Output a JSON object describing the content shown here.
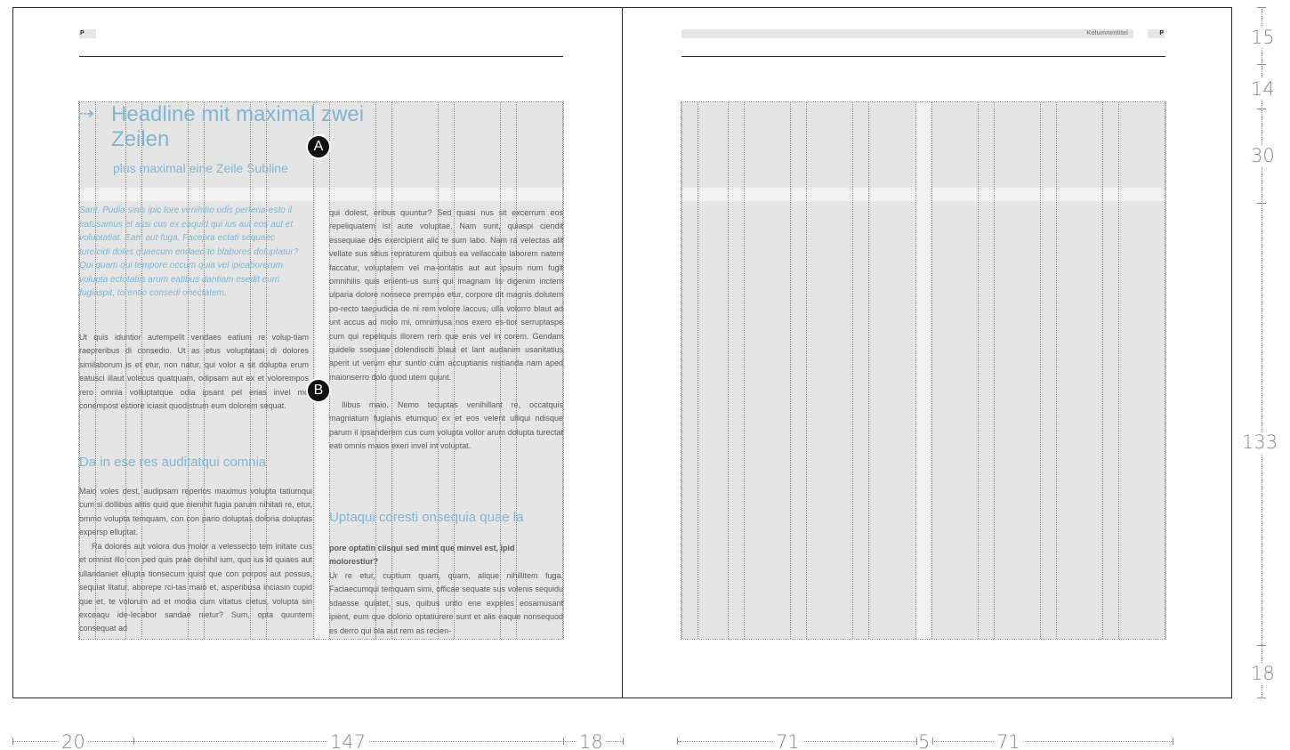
{
  "left_page": {
    "page_marker": "P",
    "headline": "Headline mit maximal zwei Zeilen",
    "headline_arrow": "⇢",
    "subline": "plus maximal eine Zeile Subline",
    "intro": "Sant. Pudia sinis ipic tore venihitio odis perferia-esto il eatusamus et assi cus ex eaquid qui ius aut eos aut et voluptatiat. Eam aut fuga. Facepra ectati sequaec tureicidi doles quaecum endaec-to blabores doluptatur? Qui quam qui tempore occum quia vel ipicaborerum volupta ectotatiis arum eatibus dantiam esedit eum fugiaspit, torentio consedi onectatem.",
    "body_1": "Ut quis iduntior autempelit vendaes eatium re volup-tiam raepreribus di consedio. Ut as etus voluptatasi di dolores similaborum is et etur, non natur, qui volor a sit doluptia erum eatusci illaut volecus quatquam, odipsam aut ex et volorempos rero omnia volluptatque odia ipsant pel erias invel mo conempost estiore iciasit quodistrum eum dolorem sequat.",
    "subhead": "Da in ese res auditatqui comnia",
    "body_2": "Maio voles dest, audipsam reperios maximus volupta tatiumqui cum si dollibus alitis quid que nienihit fugia parum nihitati re, etur, ommo volupta temquam, con con pario doluptas doloria doluptas expersp elluptat.",
    "body_2b": "Ra dolores aut volora dus molor a velessecto tem initate cus et omnist illo con ped quis prae denihil ium, quo ius id quiaes aut ullandaniet ellupta tionsecum quist que con porpos aut possus, sequiat litatur, aborepe rci-tas maio et, asperibusa inciasin cupid que et, te volorum ad et modia cum vitatus cietus, volupta sin exceaqu ide-lecabor sandae nietur? Sum, opta quuntem consequat ad",
    "body_3": "qui dolest, eribus quuntur? Sed quasi nus sit excerrum eos repeliquatem ist aute voluptae. Nam sunt, quiaspi ciendit essequiae des exercipient alic te sum labo. Nam ra velectas alit vellate sus sitius repraturem quibus ea vellaccate laborem natem faccatur, voluptatem vel ma-ioritatis aut aut ipsum num fugit omnihilis quis enienti-us sum qui imagnam lis digenim inctem ulparia dolore nonsece prempos etur, corpore dit magnis dolutem po-recto taepudicia de ni rem volore laccus, ulla volorro blaut ad unt accus ad molo mi, omnimusa nos exero es-tior serruptaspe cum qui repeliquis illorem rem que enis vel in corem. Gendam quidele ssequae dolendisciti blaut et lant audanim usanitatius aperit ut verum etur suntio cum accuptianis nistianda nam aped maionserro dolo quod utem quunt.",
    "body_3b": "Ilibus maio. Nemo tecuptas venihillant re, occatquis magniatum fugianis etumquo ex et eos velent ulliqui ndisque parum il ipsanderem cus cum volupta vollor arum dolupta turectat eati omnis maios exeri invel int voluptat.",
    "subhead_2": "Uptaqui coresti onsequia quae la",
    "bold_line": "pore optatin ciisqui sed mint que minvel est, ipid molorestiur?",
    "body_4": "Ur re etur, cuptium quam, quam, alique nihillitem fuga. Faciaecumqui temquam simi, officae sequate sus volenis sequidu sdaesse quiatet, sus, quibus untio ene expeles eosamusant ipient, eum que dolorio optatiurere sunt et alis eaque nonsequod es derro qui bla aut rem as recien-"
  },
  "right_page": {
    "running_head": "Kolumnentitel",
    "page_marker": "P"
  },
  "markers": {
    "a": "A",
    "b": "B"
  },
  "dimensions": {
    "vertical": [
      "15",
      "14",
      "30",
      "133",
      "18"
    ],
    "horizontal_left": [
      "20",
      "147",
      "18"
    ],
    "horizontal_right": [
      "71",
      "5",
      "71"
    ]
  },
  "colors": {
    "accent": "#7fb6d5",
    "grid_fill": "#e5e5e5",
    "band": "#f1f1f1",
    "frame": "#2a2a2a",
    "text": "#5a5a5a"
  }
}
